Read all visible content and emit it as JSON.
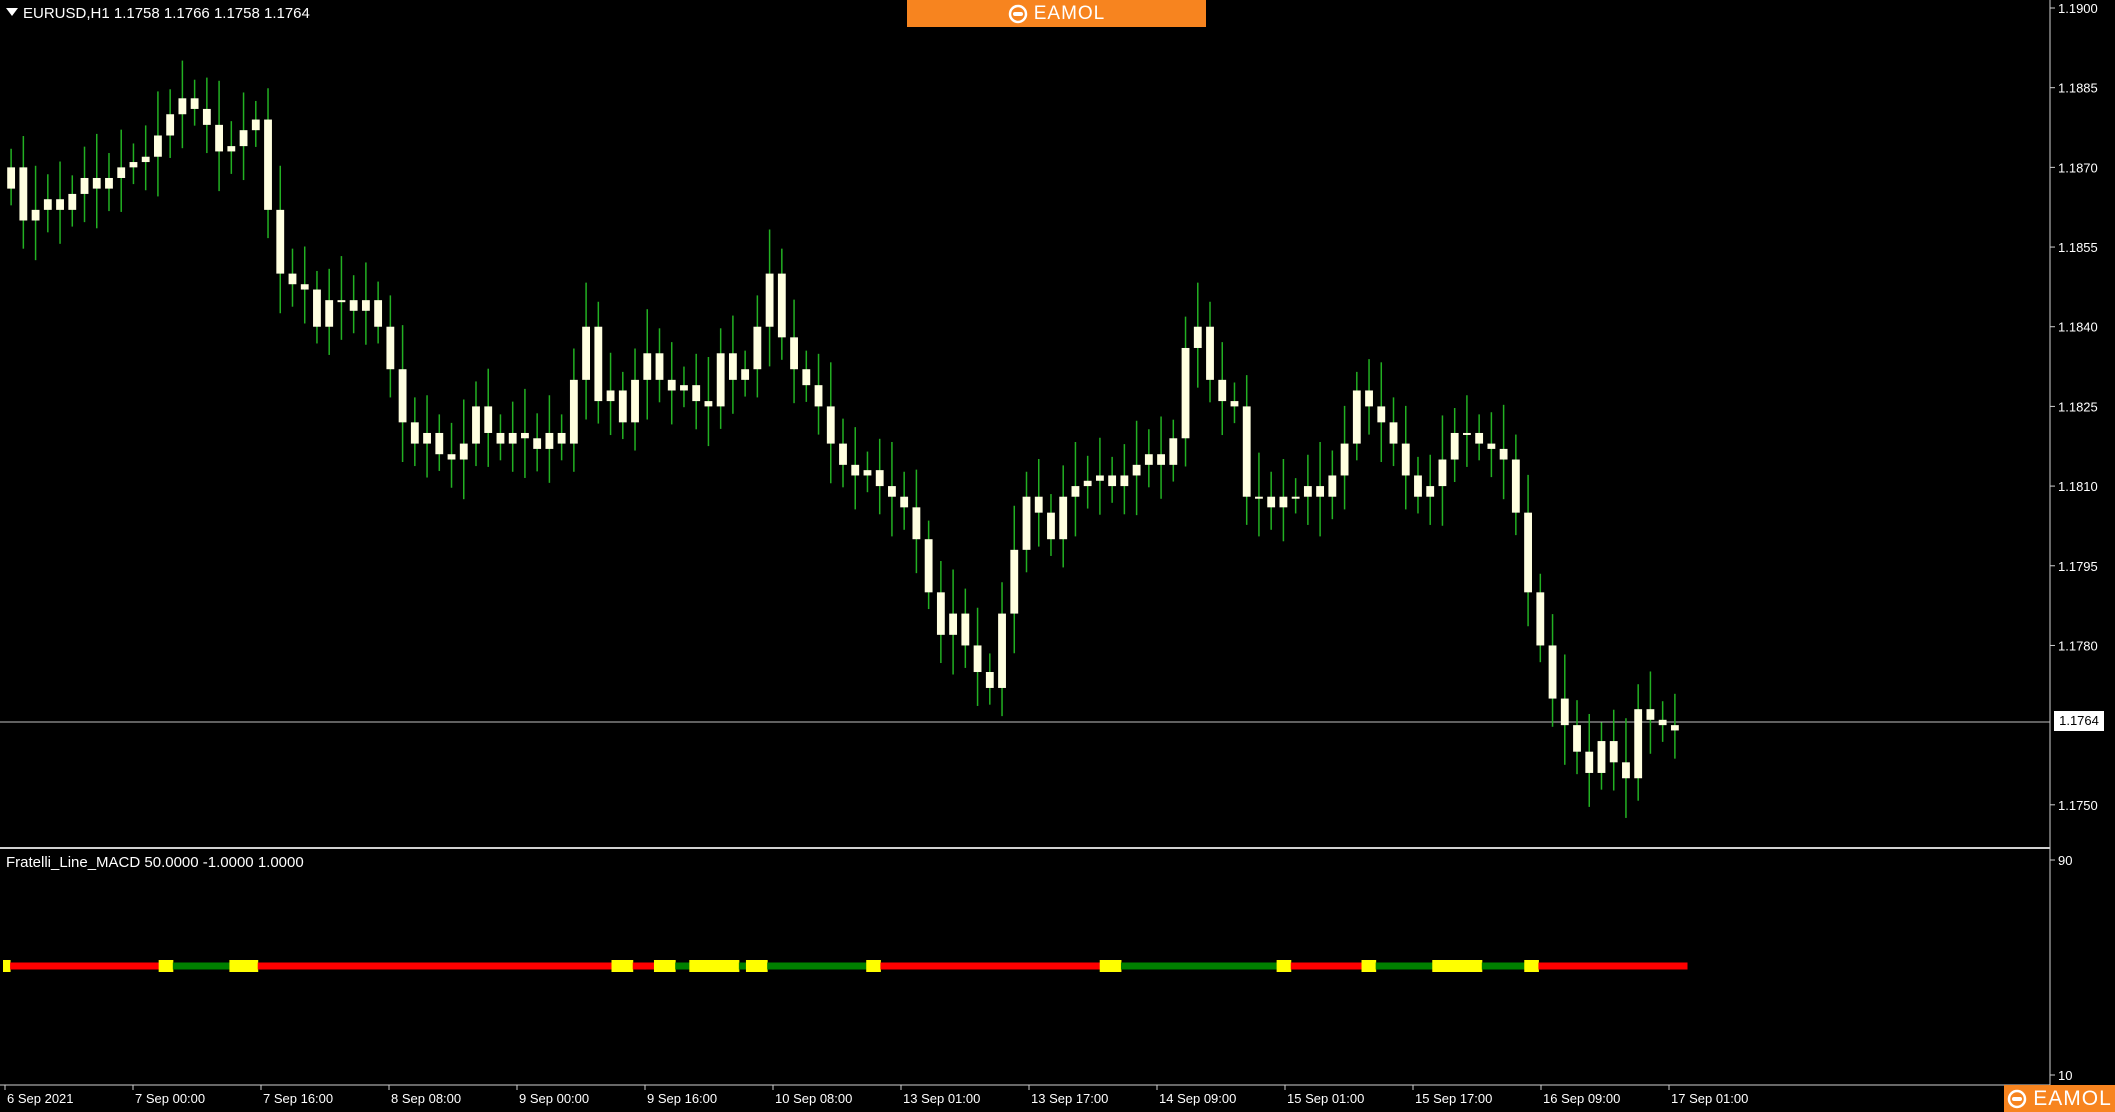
{
  "window": {
    "symbol_info": "EURUSD,H1  1.1758 1.1766 1.1758 1.1764",
    "indicator_info": "Fratelli_Line_MACD 50.0000 -1.0000 1.0000"
  },
  "branding": {
    "banner_text": "EAMOL",
    "corner_text": "EAMOL",
    "logo_icon": "eamol-logo-icon"
  },
  "colors": {
    "background": "#000000",
    "bull_candle": "#ffffe0",
    "bear_candle": "#ffffe0",
    "wick": "#22b022",
    "line_red": "#ff0000",
    "line_green": "#008000",
    "line_yellow": "#ffff00",
    "brand_orange": "#f7841f"
  },
  "price_axis": {
    "ticks": [
      "1.1900",
      "1.1885",
      "1.1870",
      "1.1855",
      "1.1840",
      "1.1825",
      "1.1810",
      "1.1795",
      "1.1780",
      "1.1764",
      "1.1750"
    ],
    "current_price": "1.1764"
  },
  "indicator_axis": {
    "ticks": [
      "90",
      "10"
    ]
  },
  "time_axis": {
    "labels": [
      "6 Sep 2021",
      "7 Sep 00:00",
      "7 Sep 16:00",
      "8 Sep 08:00",
      "9 Sep 00:00",
      "9 Sep 16:00",
      "10 Sep 08:00",
      "13 Sep 01:00",
      "13 Sep 17:00",
      "14 Sep 09:00",
      "15 Sep 01:00",
      "15 Sep 17:00",
      "16 Sep 09:00",
      "17 Sep 01:00"
    ]
  },
  "chart_data": {
    "type": "candlestick",
    "symbol": "EURUSD",
    "timeframe": "H1",
    "ylim": [
      1.1743,
      1.19
    ],
    "current_price": 1.1764,
    "closes": [
      1.187,
      1.186,
      1.1862,
      1.1864,
      1.1862,
      1.1865,
      1.1868,
      1.1866,
      1.1868,
      1.187,
      1.1871,
      1.1872,
      1.1876,
      1.188,
      1.1883,
      1.1881,
      1.1878,
      1.1873,
      1.1874,
      1.1877,
      1.1879,
      1.1862,
      1.185,
      1.1848,
      1.1847,
      1.184,
      1.1845,
      1.1845,
      1.1843,
      1.1845,
      1.184,
      1.1832,
      1.1822,
      1.1818,
      1.182,
      1.1816,
      1.1815,
      1.1818,
      1.1825,
      1.182,
      1.1818,
      1.182,
      1.1819,
      1.1817,
      1.182,
      1.1818,
      1.183,
      1.184,
      1.1826,
      1.1828,
      1.1822,
      1.183,
      1.1835,
      1.183,
      1.1828,
      1.1829,
      1.1826,
      1.1825,
      1.1835,
      1.183,
      1.1832,
      1.184,
      1.185,
      1.1838,
      1.1832,
      1.1829,
      1.1825,
      1.1818,
      1.1814,
      1.1812,
      1.1813,
      1.181,
      1.1808,
      1.1806,
      1.18,
      1.179,
      1.1782,
      1.1786,
      1.178,
      1.1775,
      1.1772,
      1.1786,
      1.1798,
      1.1808,
      1.1805,
      1.18,
      1.1808,
      1.181,
      1.1811,
      1.1812,
      1.181,
      1.1812,
      1.1814,
      1.1816,
      1.1814,
      1.1819,
      1.1836,
      1.184,
      1.183,
      1.1826,
      1.1825,
      1.1808,
      1.1808,
      1.1806,
      1.1808,
      1.1808,
      1.181,
      1.1808,
      1.1812,
      1.1818,
      1.1828,
      1.1825,
      1.1822,
      1.1818,
      1.1812,
      1.1808,
      1.181,
      1.1815,
      1.182,
      1.182,
      1.1818,
      1.1817,
      1.1815,
      1.1805,
      1.179,
      1.178,
      1.177,
      1.1765,
      1.176,
      1.1756,
      1.1762,
      1.1758,
      1.1755,
      1.1768,
      1.1766,
      1.1765,
      1.1764
    ]
  },
  "indicator_data": {
    "name": "Fratelli_Line_MACD",
    "level": 50.0,
    "ylim": [
      10,
      90
    ],
    "segments": [
      [
        "yellow",
        1
      ],
      [
        "red",
        21
      ],
      [
        "yellow",
        2
      ],
      [
        "green",
        8
      ],
      [
        "yellow",
        4
      ],
      [
        "red",
        50
      ],
      [
        "yellow",
        3
      ],
      [
        "red",
        3
      ],
      [
        "yellow",
        3
      ],
      [
        "green",
        2
      ],
      [
        "yellow",
        7
      ],
      [
        "green",
        1
      ],
      [
        "yellow",
        3
      ],
      [
        "green",
        14
      ],
      [
        "yellow",
        2
      ],
      [
        "red",
        31
      ],
      [
        "yellow",
        3
      ],
      [
        "green",
        22
      ],
      [
        "yellow",
        2
      ],
      [
        "red",
        10
      ],
      [
        "yellow",
        2
      ],
      [
        "green",
        8
      ],
      [
        "yellow",
        7
      ],
      [
        "green",
        6
      ],
      [
        "yellow",
        2
      ],
      [
        "red",
        21
      ]
    ]
  }
}
